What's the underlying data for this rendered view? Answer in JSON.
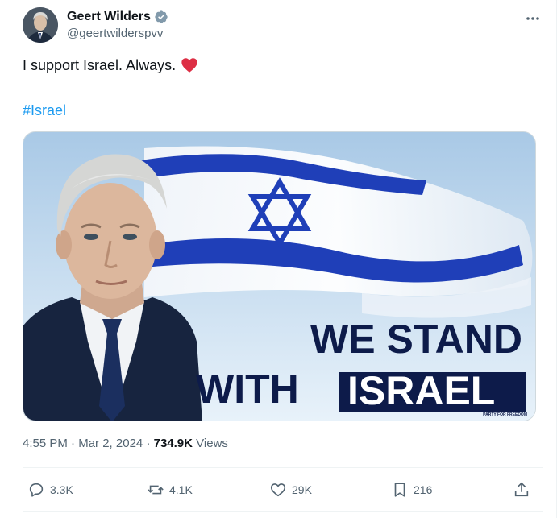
{
  "author": {
    "display_name": "Geert Wilders",
    "handle": "@geertwilderspvv",
    "verified": true,
    "verified_color": "#829aab"
  },
  "more_icon": "more-horizontal-icon",
  "tweet": {
    "text": "I support Israel. Always.",
    "emoji": "red-heart",
    "hashtag": "#Israel"
  },
  "media": {
    "headline_line1": "WE STAND",
    "headline_with": "WITH",
    "headline_israel": "ISRAEL",
    "party_tag": "PARTY FOR FREEDOM"
  },
  "meta": {
    "time": "4:55 PM",
    "separator": "·",
    "date": "Mar 2, 2024",
    "views_count": "734.9K",
    "views_label": "Views"
  },
  "actions": {
    "replies": "3.3K",
    "reposts": "4.1K",
    "likes": "29K",
    "bookmarks": "216"
  },
  "colors": {
    "link": "#1d9bf0",
    "secondary_text": "#536471",
    "primary_text": "#0f1419",
    "poster_navy": "#0d1b4a",
    "flag_blue": "#1f3fb8"
  }
}
